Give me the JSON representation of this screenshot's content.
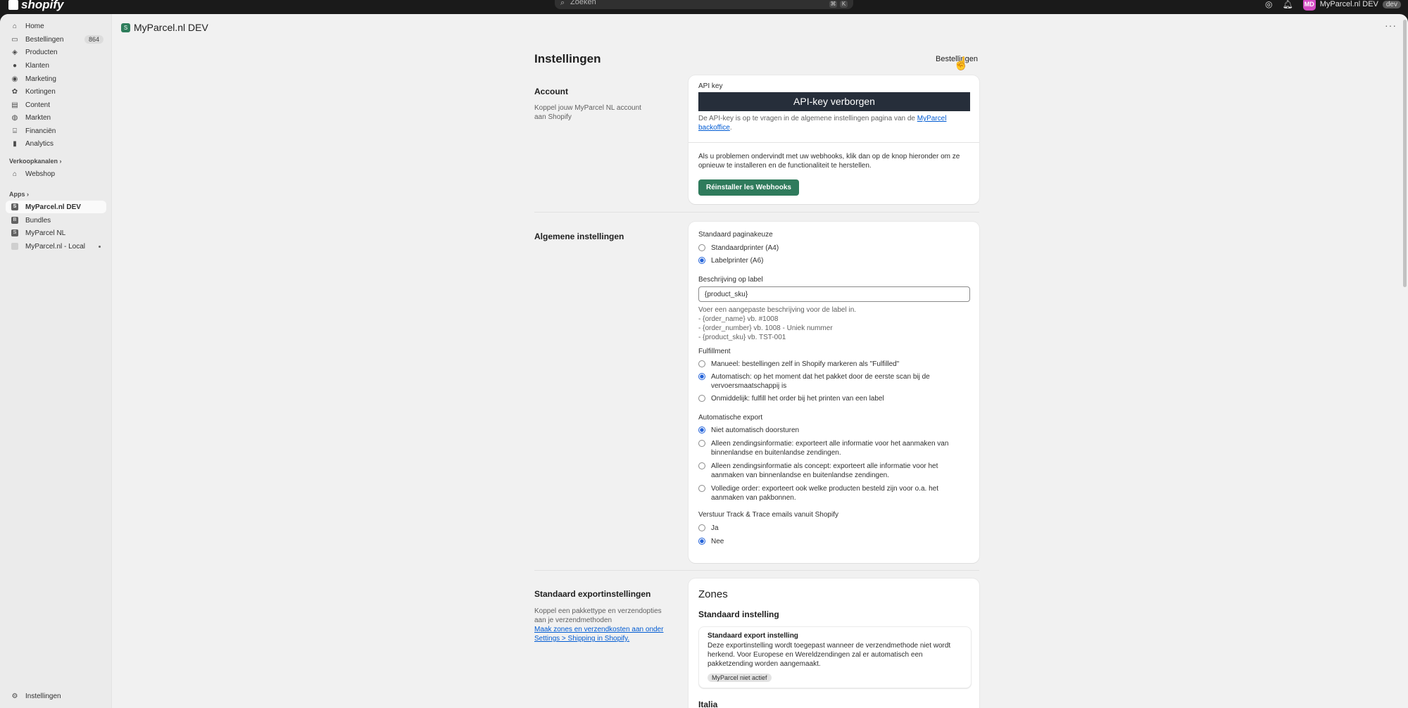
{
  "topbar": {
    "logo_text": "shopify",
    "search_placeholder": "Zoeken",
    "search_kbd": [
      "⌘",
      "K"
    ],
    "store_initials": "MD",
    "store_name": "MyParcel.nl DEV",
    "store_badge": "dev"
  },
  "sidebar": {
    "items": [
      {
        "label": "Home",
        "icon": "home-icon"
      },
      {
        "label": "Bestellingen",
        "icon": "inbox-icon",
        "count": "864"
      },
      {
        "label": "Producten",
        "icon": "tag-icon"
      },
      {
        "label": "Klanten",
        "icon": "person-icon"
      },
      {
        "label": "Marketing",
        "icon": "target-icon"
      },
      {
        "label": "Kortingen",
        "icon": "discount-icon"
      },
      {
        "label": "Content",
        "icon": "content-icon"
      },
      {
        "label": "Markten",
        "icon": "globe-icon"
      },
      {
        "label": "Financiën",
        "icon": "bank-icon"
      },
      {
        "label": "Analytics",
        "icon": "chart-icon"
      }
    ],
    "sales_channels_label": "Verkoopkanalen",
    "sales_channels": [
      {
        "label": "Webshop",
        "icon": "store-icon"
      }
    ],
    "apps_label": "Apps",
    "apps": [
      {
        "label": "MyParcel.nl DEV",
        "active": true
      },
      {
        "label": "Bundles"
      },
      {
        "label": "MyParcel NL"
      },
      {
        "label": "MyParcel.nl - Local"
      }
    ],
    "settings_label": "Instellingen"
  },
  "app_header": {
    "title": "MyParcel.nl DEV",
    "more": "···"
  },
  "page": {
    "title": "Instellingen",
    "title_link": "Bestellingen"
  },
  "account": {
    "title": "Account",
    "description": "Koppel jouw MyParcel NL account aan Shopify",
    "api_label": "API key",
    "api_value": "API-key verborgen",
    "api_help_prefix": "De API-key is op te vragen in de algemene instellingen pagina van de",
    "api_help_link": "MyParcel backoffice",
    "api_help_suffix": ".",
    "webhooks_text": "Als u problemen ondervindt met uw webhooks, klik dan op de knop hieronder om ze opnieuw te installeren en de functionaliteit te herstellen.",
    "webhooks_button": "Réinstaller les Webhooks"
  },
  "general": {
    "title": "Algemene instellingen",
    "page_choice_label": "Standaard paginakeuze",
    "page_choice_options": [
      "Standaardprinter (A4)",
      "Labelprinter (A6)"
    ],
    "page_choice_selected": 1,
    "label_desc_label": "Beschrijving op label",
    "label_desc_value": "{product_sku}",
    "label_help": [
      "Voer een aangepaste beschrijving voor de label in.",
      "- {order_name} vb. #1008",
      "- {order_number} vb. 1008 - Uniek nummer",
      "- {product_sku} vb. TST-001"
    ],
    "fulfillment_label": "Fulfillment",
    "fulfillment_options": [
      "Manueel: bestellingen zelf in Shopify markeren als \"Fulfilled\"",
      "Automatisch: op het moment dat het pakket door de eerste scan bij de vervoersmaatschappij is",
      "Onmiddelijk: fulfill het order bij het printen van een label"
    ],
    "fulfillment_selected": 1,
    "auto_export_label": "Automatische export",
    "auto_export_options": [
      "Niet automatisch doorsturen",
      "Alleen zendingsinformatie: exporteert alle informatie voor het aanmaken van binnenlandse en buitenlandse zendingen.",
      "Alleen zendingsinformatie als concept: exporteert alle informatie voor het aanmaken van binnenlandse en buitenlandse zendingen.",
      "Volledige order: exporteert ook welke producten besteld zijn voor o.a. het aanmaken van pakbonnen."
    ],
    "auto_export_selected": 0,
    "track_label": "Verstuur Track & Trace emails vanuit Shopify",
    "track_options": [
      "Ja",
      "Nee"
    ],
    "track_selected": 1
  },
  "export": {
    "title": "Standaard exportinstellingen",
    "description": "Koppel een pakkettype en verzendopties aan je verzendmethoden",
    "link": "Maak zones en verzendkosten aan onder Settings > Shipping in Shopify.",
    "zones_title": "Zones",
    "standard_heading": "Standaard instelling",
    "inner_title": "Standaard export instelling",
    "inner_text": "Deze exportinstelling wordt toegepast wanneer de verzendmethode niet wordt herkend. Voor Europese en Wereldzendingen zal er automatisch een pakketzending worden aangemaakt.",
    "inner_badge": "MyParcel niet actief",
    "next_zone": "Italia"
  }
}
